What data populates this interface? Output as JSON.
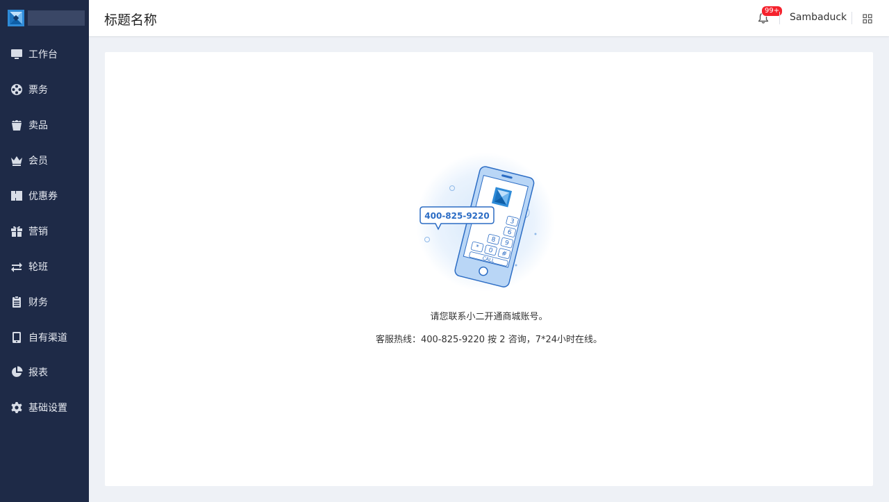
{
  "header": {
    "title": "标题名称",
    "notification_badge": "99+",
    "username": "Sambaduck"
  },
  "sidebar": {
    "items": [
      {
        "label": "工作台",
        "icon": "monitor-icon"
      },
      {
        "label": "票务",
        "icon": "film-reel-icon"
      },
      {
        "label": "卖品",
        "icon": "popcorn-icon"
      },
      {
        "label": "会员",
        "icon": "crown-icon"
      },
      {
        "label": "优惠券",
        "icon": "ticket-icon"
      },
      {
        "label": "营销",
        "icon": "gift-icon"
      },
      {
        "label": "轮班",
        "icon": "swap-arrows-icon"
      },
      {
        "label": "财务",
        "icon": "clipboard-icon"
      },
      {
        "label": "自有渠道",
        "icon": "tablet-icon"
      },
      {
        "label": "报表",
        "icon": "pie-chart-icon"
      },
      {
        "label": "基础设置",
        "icon": "gear-icon"
      }
    ]
  },
  "main": {
    "illustration": {
      "phone_number": "400-825-9220",
      "keypad": [
        "3",
        "6",
        "8",
        "9",
        "*",
        "0",
        "#"
      ],
      "call_label": "CALL"
    },
    "message_line1": "请您联系小二开通商城账号。",
    "message_line2": "客服热线：400-825-9220 按 2 咨询，7*24小时在线。"
  },
  "colors": {
    "sidebar_bg": "#1e2a47",
    "page_bg": "#eef1f6",
    "accent": "#2b6cc4",
    "badge": "#f5222d"
  }
}
